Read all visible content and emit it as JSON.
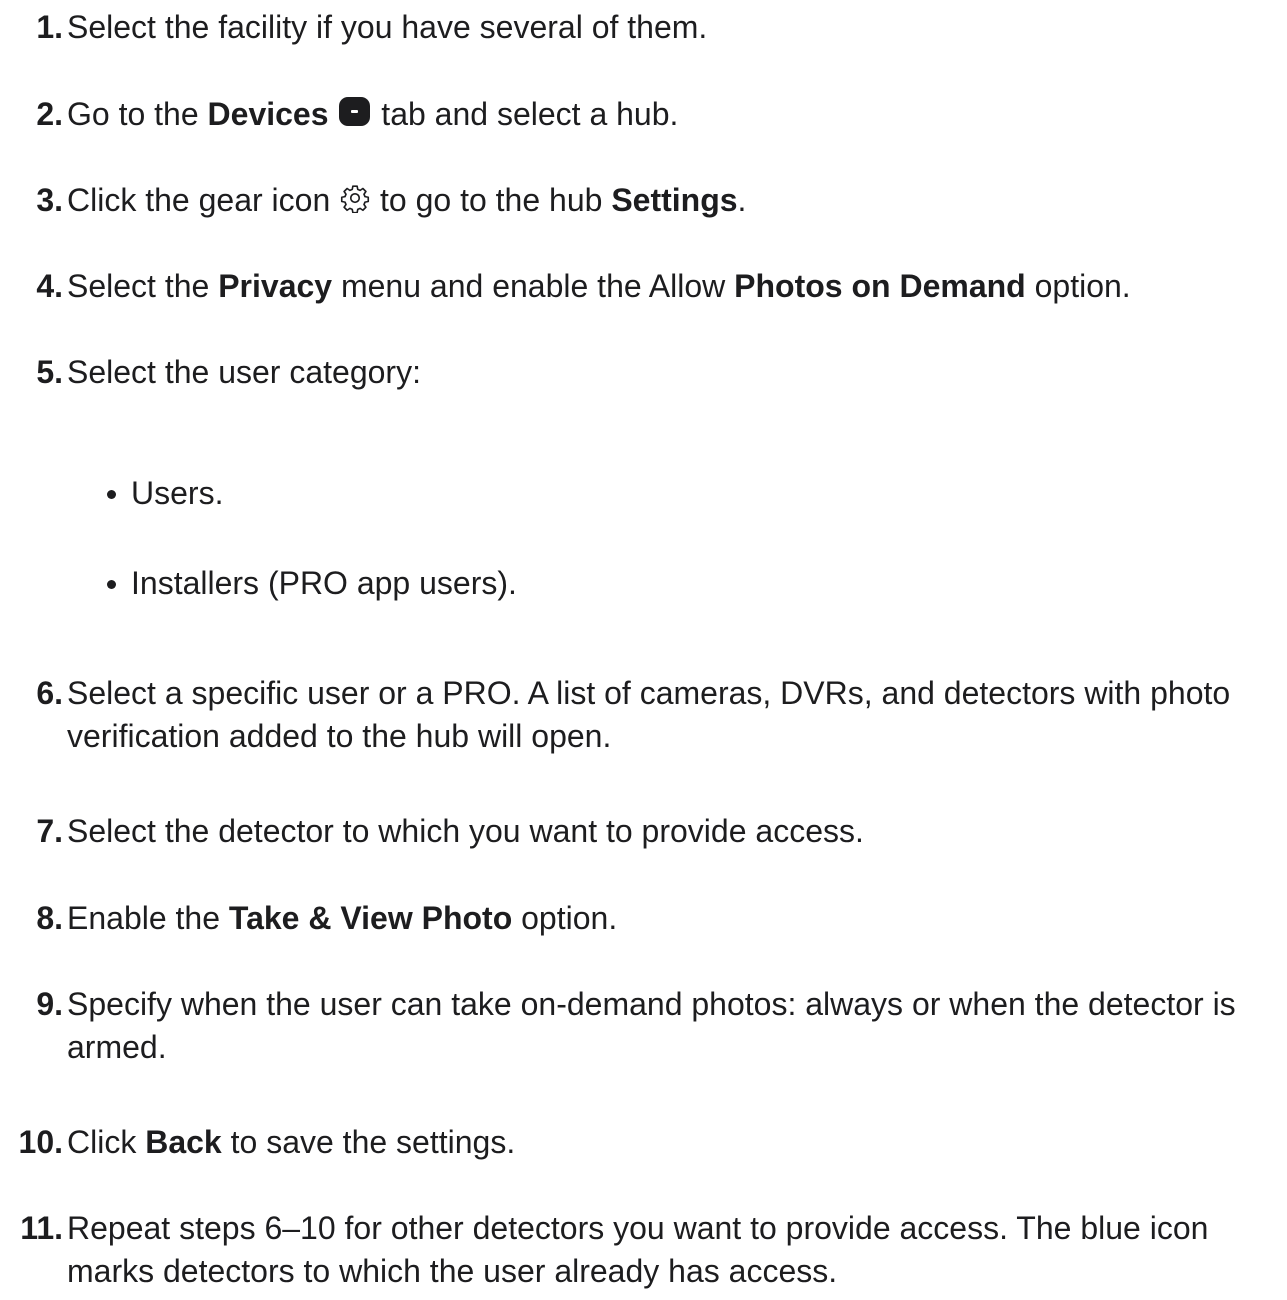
{
  "steps": [
    {
      "num": "1.",
      "text": "Select the facility if you have several of them."
    },
    {
      "num": "2.",
      "pre": "Go to the ",
      "bold": "Devices",
      "post": " tab and select a hub.",
      "icon": "devices-tab-icon"
    },
    {
      "num": "3.",
      "pre": "Click the gear icon ",
      "mid": " to go to the hub ",
      "bold": "Settings",
      "post": ".",
      "icon": "gear-icon"
    },
    {
      "num": "4.",
      "pre": "Select the ",
      "bold1": "Privacy",
      "mid": " menu and enable the Allow ",
      "bold2": "Photos on Demand",
      "post": " option."
    },
    {
      "num": "5.",
      "text": "Select the user category:",
      "bullets": [
        "Users.",
        "Installers (PRO app users)."
      ]
    },
    {
      "num": "6.",
      "text": "Select a specific user or a PRO. A list of cameras, DVRs, and detectors with photo verification added to the hub will open."
    },
    {
      "num": "7.",
      "text": "Select the detector to which you want to provide access."
    },
    {
      "num": "8.",
      "pre": "Enable the ",
      "bold": "Take & View Photo",
      "post": " option."
    },
    {
      "num": "9.",
      "text": "Specify when the user can take on-demand photos: always or when the detector is armed."
    },
    {
      "num": "10.",
      "pre": "Click ",
      "bold": "Back",
      "post": " to save the settings."
    },
    {
      "num": "11.",
      "text": "Repeat steps 6–10 for other detectors you want to provide access. The blue icon marks detectors to which the user already has access."
    }
  ],
  "colors": {
    "text": "#1d1d1f",
    "background": "#ffffff"
  }
}
